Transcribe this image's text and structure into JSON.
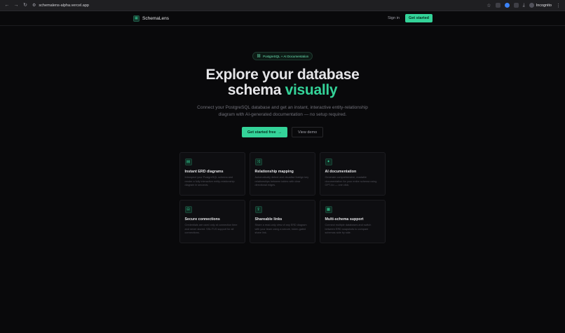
{
  "browser": {
    "url": "schemalens-alpha.vercel.app",
    "incognito_label": "Incognito"
  },
  "nav": {
    "brand": "SchemaLens",
    "signin": "Sign in",
    "get_started": "Get started"
  },
  "hero": {
    "pill": "PostgreSQL + AI Documentation",
    "title_line1": "Explore your database",
    "title_line2_prefix": "schema ",
    "title_line2_accent": "visually",
    "subtitle": "Connect your PostgreSQL database and get an instant, interactive entity-relationship diagram with AI-generated documentation — no setup required.",
    "cta_primary": "Get started free",
    "cta_secondary": "View demo"
  },
  "features": [
    {
      "icon": "database-icon",
      "title": "Instant ERD diagrams",
      "desc": "Introspect your PostgreSQL schema and render a fully interactive entity-relationship diagram in seconds."
    },
    {
      "icon": "relationship-icon",
      "title": "Relationship mapping",
      "desc": "Automatically detect and visualise foreign key relationships between tables with clear directional edges."
    },
    {
      "icon": "sparkles-icon",
      "title": "AI documentation",
      "desc": "Generate comprehensive, readable documentation for your entire schema using GPT-4o — one click."
    },
    {
      "icon": "lock-icon",
      "title": "Secure connections",
      "desc": "Credentials are used only at connection time and never stored. SSL/TLS support for all connections."
    },
    {
      "icon": "share-icon",
      "title": "Shareable links",
      "desc": "Share a read-only view of any ERD diagram with your team using a secure, token-gated share link."
    },
    {
      "icon": "grid-icon",
      "title": "Multi-schema support",
      "desc": "Connect multiple databases and switch between ERD snapshots to compare schemas side by side."
    }
  ]
}
